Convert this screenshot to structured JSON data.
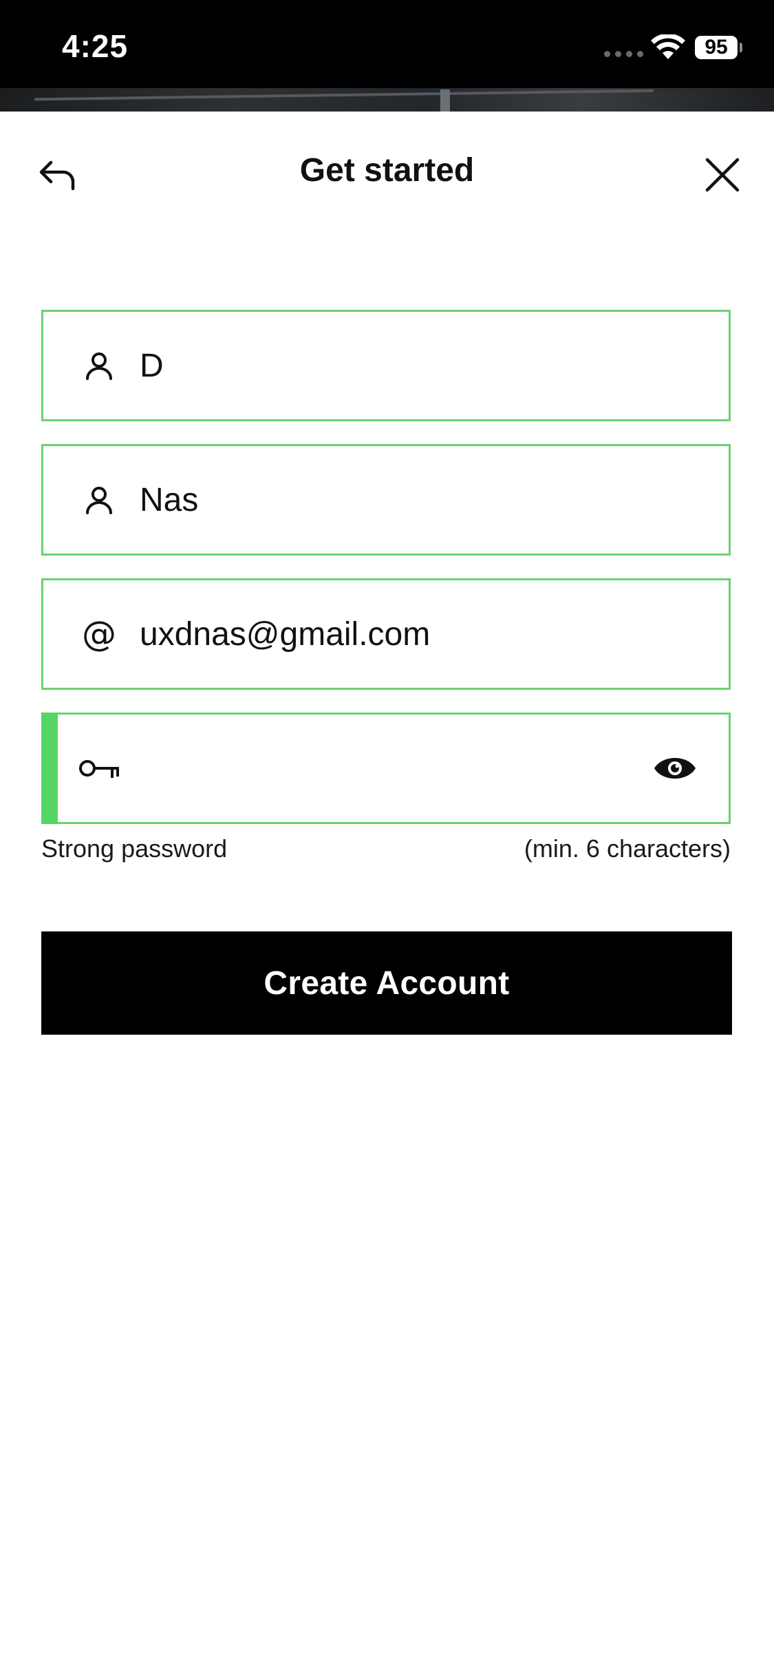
{
  "status_bar": {
    "time": "4:25",
    "battery": "95"
  },
  "header": {
    "title": "Get started",
    "back_icon": "back-arrow-icon",
    "close_icon": "close-icon"
  },
  "form": {
    "first_name": {
      "value": "D",
      "icon": "person-icon"
    },
    "last_name": {
      "value": "Nas",
      "icon": "person-icon"
    },
    "email": {
      "value": "uxdnas@gmail.com",
      "icon": "at-icon",
      "icon_glyph": "@"
    },
    "password": {
      "value": "",
      "icon": "key-icon",
      "toggle_icon": "eye-icon"
    },
    "strength_label": "Strong password",
    "requirement_label": "(min. 6 characters)",
    "submit_label": "Create Account"
  },
  "colors": {
    "field_border": "#6ccf74",
    "strength_indicator": "#56d563",
    "button_background": "#000000"
  }
}
